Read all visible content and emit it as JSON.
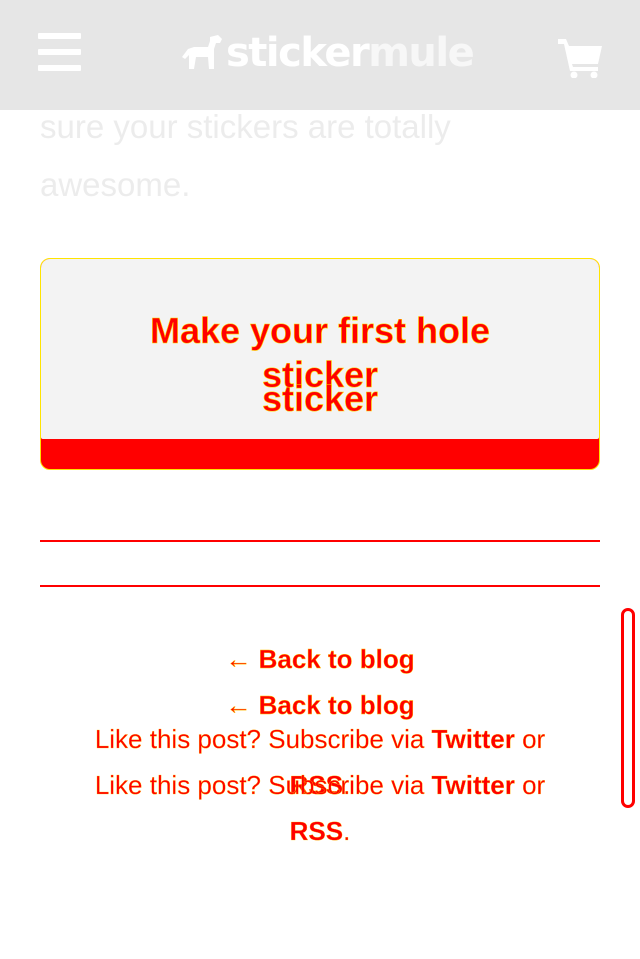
{
  "header": {
    "logo_part1": "sticker",
    "logo_part2": "mule"
  },
  "intro": {
    "line1": "sure your stickers are totally",
    "line2": "awesome."
  },
  "cta": {
    "line1": "Make your first hole",
    "line2": "sticker"
  },
  "footer": {
    "back_to_blog": "← Back to blog",
    "subscribe_prefix": "Like this post? Subscribe via ",
    "twitter": "Twitter",
    "or": " or",
    "rss": "RSS",
    "period": "."
  },
  "icons": {
    "menu": "hamburger-menu-icon",
    "logo": "mule-logo-icon",
    "cart": "shopping-cart-icon"
  },
  "colors": {
    "header_bg": "#e6e6e6",
    "accent": "#ff0000",
    "highlight": "#ffd400",
    "button_face": "#f3f3f3"
  }
}
